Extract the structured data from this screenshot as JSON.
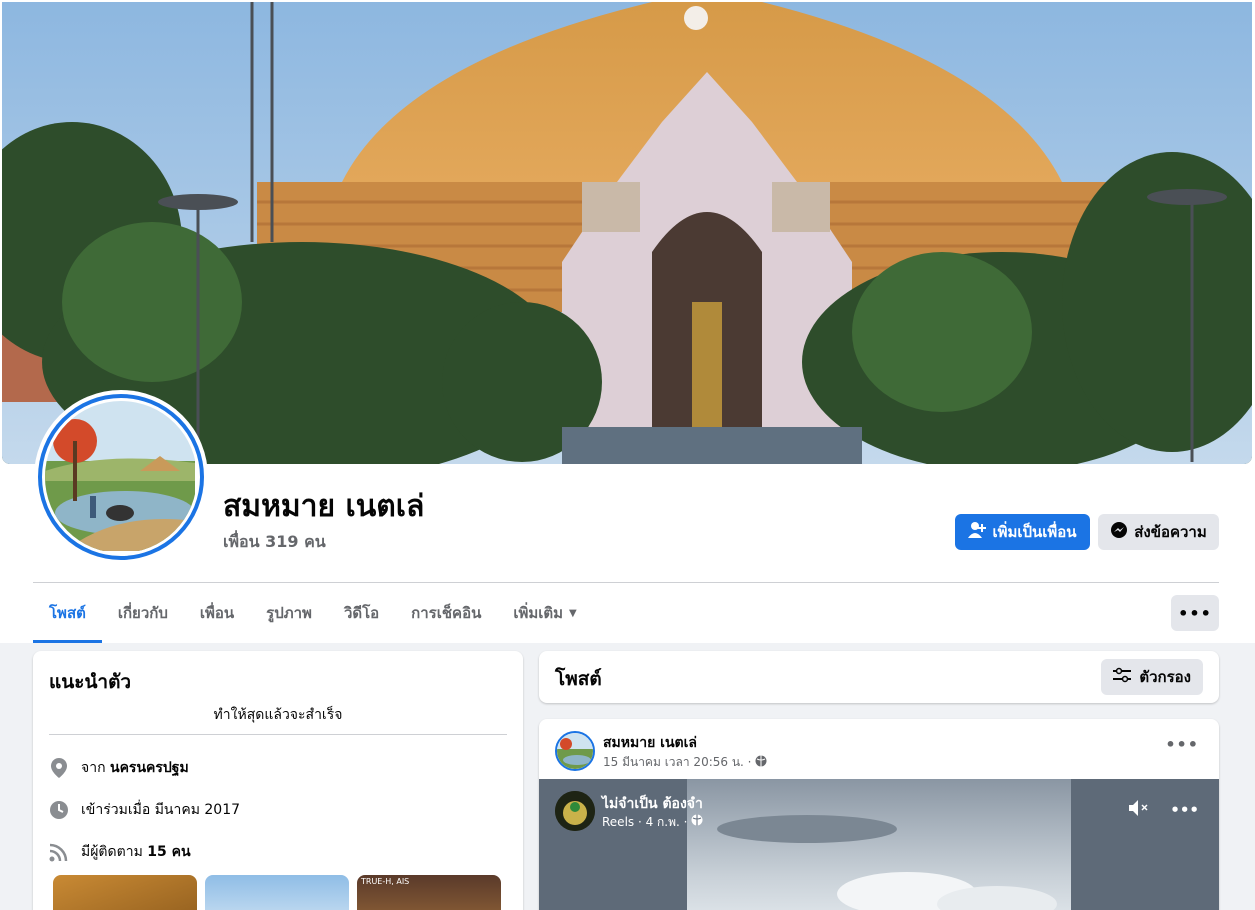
{
  "profile": {
    "name": "สมหมาย เนตเล่",
    "friends": "เพื่อน 319 คน"
  },
  "actions": {
    "add_friend": "เพิ่มเป็นเพื่อน",
    "message": "ส่งข้อความ",
    "more": "•••"
  },
  "tabs": [
    {
      "label": "โพสต์",
      "active": true
    },
    {
      "label": "เกี่ยวกับ"
    },
    {
      "label": "เพื่อน"
    },
    {
      "label": "รูปภาพ"
    },
    {
      "label": "วิดีโอ"
    },
    {
      "label": "การเช็คอิน"
    },
    {
      "label": "เพิ่มเติม"
    }
  ],
  "intro": {
    "title": "แนะนำตัว",
    "complete": "ทำให้สุดแล้วจะสำเร็จ",
    "from_prefix": "จาก",
    "from_value": "นครนครปฐม",
    "joined": "เข้าร่วมเมื่อ มีนาคม 2017",
    "followers_prefix": "มีผู้ติดตาม",
    "followers_value": "15 คน",
    "thumb3_label": "TRUE-H, AIS"
  },
  "posts": {
    "title": "โพสต์",
    "filter": "ตัวกรอง"
  },
  "post": {
    "author": "สมหมาย เนตเล่",
    "time": "15 มีนาคม เวลา 20:56 น. ·",
    "more": "•••",
    "reel_title": "ไม่จำเป็น ต้องจำ",
    "reel_meta": "Reels · 4 ก.พ. ·"
  },
  "colors": {
    "accent": "#1b74e4",
    "background": "#f0f2f5",
    "secondary_button": "#e4e6eb"
  }
}
